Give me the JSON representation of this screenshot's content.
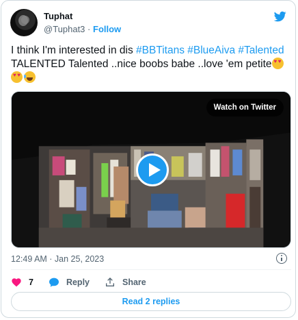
{
  "user": {
    "name": "Tuphat",
    "handle": "@Tuphat3",
    "separator": "·",
    "follow_label": "Follow"
  },
  "tweet": {
    "text_prefix": "I think I'm interested in dis ",
    "hashtags": [
      "#BBTitans",
      "#BlueAiva",
      "#Talented"
    ],
    "text_body": "TALENTED Talented ..nice boobs babe ..love 'em petite",
    "emojis": [
      "smiling-face-with-heart-eyes",
      "smiling-face-with-heart-eyes",
      "face-with-tears-of-joy"
    ]
  },
  "media": {
    "watch_label": "Watch on Twitter",
    "play_icon": "play-icon"
  },
  "meta": {
    "timestamp": "12:49 AM · Jan 25, 2023"
  },
  "actions": {
    "like_count": "7",
    "reply_label": "Reply",
    "share_label": "Share"
  },
  "read_replies_label": "Read 2 replies",
  "colors": {
    "accent": "#1d9bf0",
    "like": "#f91880",
    "text": "#0f1419",
    "muted": "#536471",
    "border": "#cfd9de"
  }
}
